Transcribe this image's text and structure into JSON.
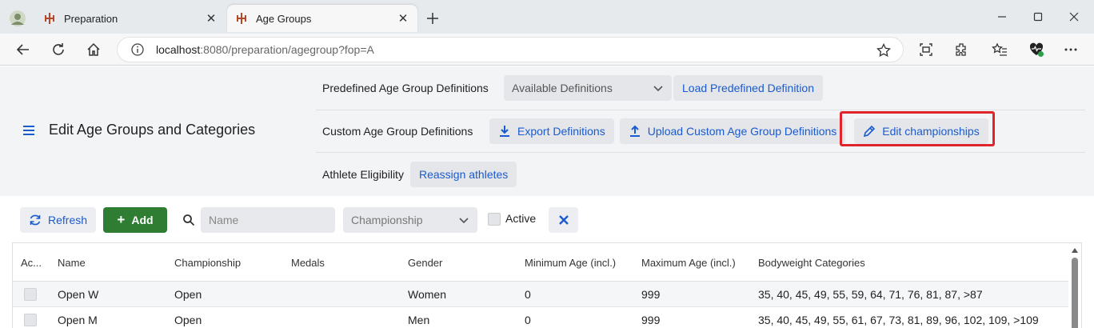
{
  "browser": {
    "tabs": [
      {
        "title": "Preparation",
        "active": false
      },
      {
        "title": "Age Groups",
        "active": true
      }
    ],
    "url_host": "localhost",
    "url_rest": ":8080/preparation/agegroup?fop=A"
  },
  "header": {
    "title": "Edit Age Groups and Categories",
    "predefined_label": "Predefined Age Group Definitions",
    "available_definitions": "Available Definitions",
    "load_predefined": "Load Predefined Definition",
    "custom_label": "Custom Age Group Definitions",
    "export_definitions": "Export Definitions",
    "upload_custom": "Upload Custom Age Group Definitions",
    "edit_championships": "Edit championships",
    "eligibility_label": "Athlete Eligibility",
    "reassign_athletes": "Reassign athletes"
  },
  "toolbar": {
    "refresh": "Refresh",
    "add": "Add",
    "name_placeholder": "Name",
    "championship_placeholder": "Championship",
    "active_label": "Active"
  },
  "grid": {
    "columns": [
      "Ac...",
      "Name",
      "Championship",
      "Medals",
      "Gender",
      "Minimum Age (incl.)",
      "Maximum Age (incl.)",
      "Bodyweight Categories"
    ],
    "rows": [
      {
        "active": false,
        "name": "Open W",
        "championship": "Open",
        "medals": "",
        "gender": "Women",
        "min_age": "0",
        "max_age": "999",
        "bw": "35, 40, 45, 49, 55, 59, 64, 71, 76, 81, 87, >87"
      },
      {
        "active": false,
        "name": "Open M",
        "championship": "Open",
        "medals": "",
        "gender": "Men",
        "min_age": "0",
        "max_age": "999",
        "bw": "35, 40, 45, 49, 55, 61, 67, 73, 81, 89, 96, 102, 109, >109"
      }
    ]
  },
  "colors": {
    "accent": "#1a5bd0",
    "add_green": "#2e7d32",
    "highlight_red": "#e0242b"
  }
}
